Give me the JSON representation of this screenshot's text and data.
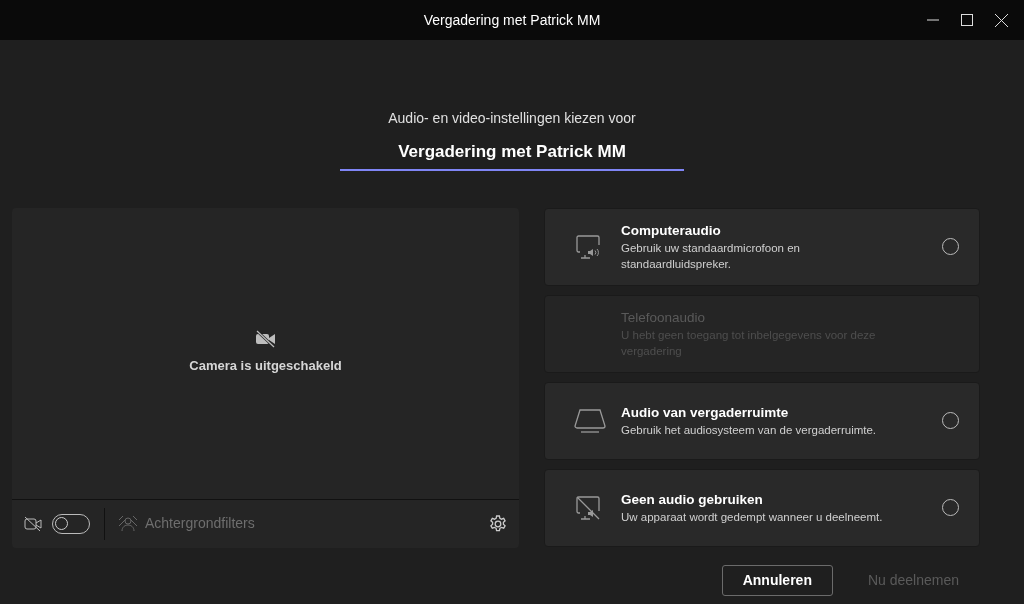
{
  "window": {
    "title": "Vergadering met Patrick MM"
  },
  "heading": "Audio- en video-instellingen kiezen voor",
  "meeting_title": "Vergadering met Patrick MM",
  "video": {
    "status": "Camera is uitgeschakeld",
    "camera_on": false,
    "background_filters": {
      "label": "Achtergrondfilters",
      "disabled": true
    }
  },
  "audio_options": [
    {
      "kind": "computer",
      "title": "Computeraudio",
      "description": "Gebruik uw standaardmicrofoon en standaardluidspreker.",
      "disabled": false,
      "selected": false
    },
    {
      "kind": "phone",
      "title": "Telefoonaudio",
      "description": "U hebt geen toegang tot inbelgegevens voor deze vergadering",
      "disabled": true,
      "selected": false
    },
    {
      "kind": "room",
      "title": "Audio van vergaderruimte",
      "description": "Gebruik het audiosysteem van de vergaderruimte.",
      "disabled": false,
      "selected": false
    },
    {
      "kind": "none",
      "title": "Geen audio gebruiken",
      "description": "Uw apparaat wordt gedempt wanneer u deelneemt.",
      "disabled": false,
      "selected": false
    }
  ],
  "buttons": [
    {
      "label": "Annuleren",
      "disabled": false
    },
    {
      "label": "Nu deelnemen",
      "disabled": true
    }
  ]
}
